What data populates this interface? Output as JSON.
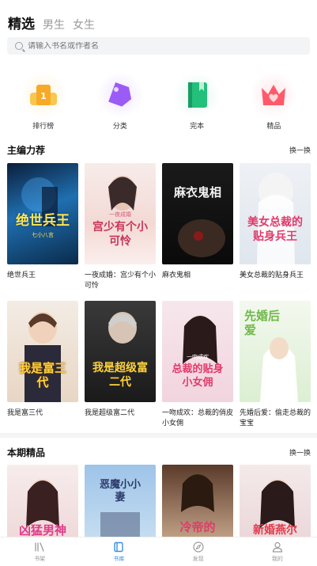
{
  "tabs": [
    {
      "label": "精选",
      "active": true
    },
    {
      "label": "男生",
      "active": false
    },
    {
      "label": "女生",
      "active": false
    }
  ],
  "search": {
    "placeholder": "请输入书名或作者名"
  },
  "categories": [
    {
      "label": "排行榜",
      "icon": "trophy-icon",
      "color": "#f7b42c"
    },
    {
      "label": "分类",
      "icon": "tag-icon",
      "color": "#9b5cf6"
    },
    {
      "label": "完本",
      "icon": "book-icon",
      "color": "#22c07a"
    },
    {
      "label": "精品",
      "icon": "crown-icon",
      "color": "#ff5a6a"
    }
  ],
  "editor_picks": {
    "title": "主编力荐",
    "more": "换一换",
    "books": [
      {
        "title": "绝世兵王",
        "cover_text": "绝世兵王",
        "cover_sub": "七小八言"
      },
      {
        "title": "一夜成婚：宫少有个小可怜",
        "cover_text": "宫少有个小可怜",
        "cover_sub": "一夜成婚"
      },
      {
        "title": "麻衣鬼相",
        "cover_text": "麻衣鬼相",
        "cover_sub": ""
      },
      {
        "title": "美女总裁的贴身兵王",
        "cover_text": "美女总裁的贴身兵王",
        "cover_sub": ""
      },
      {
        "title": "我是富三代",
        "cover_text": "我是富三代",
        "cover_sub": ""
      },
      {
        "title": "我是超级富二代",
        "cover_text": "我是超级富二代",
        "cover_sub": ""
      },
      {
        "title": "一吻成欢：总裁的俏皮小女佣",
        "cover_text": "总裁的贴身小女佣",
        "cover_sub": "一吻成欢"
      },
      {
        "title": "先婚后爱：偷走总裁的宝宝",
        "cover_text": "先婚后爱",
        "cover_sub": ""
      }
    ]
  },
  "this_issue": {
    "title": "本期精品",
    "more": "换一换",
    "books": [
      {
        "cover_text": "凶猛男神"
      },
      {
        "cover_text": "恶魔小小妻"
      },
      {
        "cover_text": "冷帝的"
      },
      {
        "cover_text": "新婚燕尔"
      }
    ]
  },
  "bottom_nav": [
    {
      "label": "书架",
      "icon": "bookshelf-icon",
      "active": false
    },
    {
      "label": "书库",
      "icon": "library-icon",
      "active": true
    },
    {
      "label": "发现",
      "icon": "compass-icon",
      "active": false
    },
    {
      "label": "我的",
      "icon": "user-icon",
      "active": false
    }
  ],
  "colors": {
    "accent": "#3a8ee6",
    "search_bg": "#f3f4f6"
  }
}
